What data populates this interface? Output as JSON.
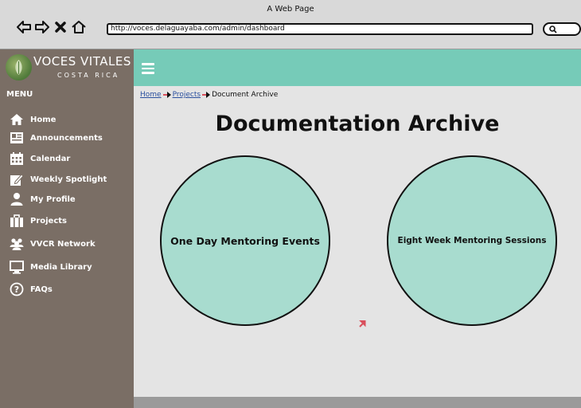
{
  "browser": {
    "window_title": "A Web Page",
    "url": "http://voces.delaguayaba.com/admin/dashboard"
  },
  "brand": {
    "name": "VOCES VITALES",
    "subtitle": "COSTA RICA"
  },
  "colors": {
    "header_teal": "#76cbb8",
    "sidebar_brown": "#7a6e65",
    "circle_fill": "#a8dccf",
    "content_bg": "#e4e4e4",
    "link_blue": "#2a4f9e"
  },
  "sidebar": {
    "menu_title": "MENU",
    "items": [
      {
        "label": "Home",
        "icon": "home-icon"
      },
      {
        "label": "Announcements",
        "icon": "newspaper-icon"
      },
      {
        "label": "Calendar",
        "icon": "calendar-icon"
      },
      {
        "label": "Weekly Spotlight",
        "icon": "edit-icon"
      },
      {
        "label": "My Profile",
        "icon": "user-icon"
      },
      {
        "label": "Projects",
        "icon": "folder-icon"
      },
      {
        "label": "VVCR Network",
        "icon": "users-icon"
      },
      {
        "label": "Media Library",
        "icon": "monitor-icon"
      },
      {
        "label": "FAQs",
        "icon": "question-icon"
      }
    ]
  },
  "breadcrumb": {
    "home": "Home",
    "projects": "Projects",
    "current": "Document Archive"
  },
  "main": {
    "title": "Documentation Archive",
    "circles": [
      {
        "label": "One Day Mentoring Events"
      },
      {
        "label": "Eight Week Mentoring Sessions"
      }
    ]
  }
}
